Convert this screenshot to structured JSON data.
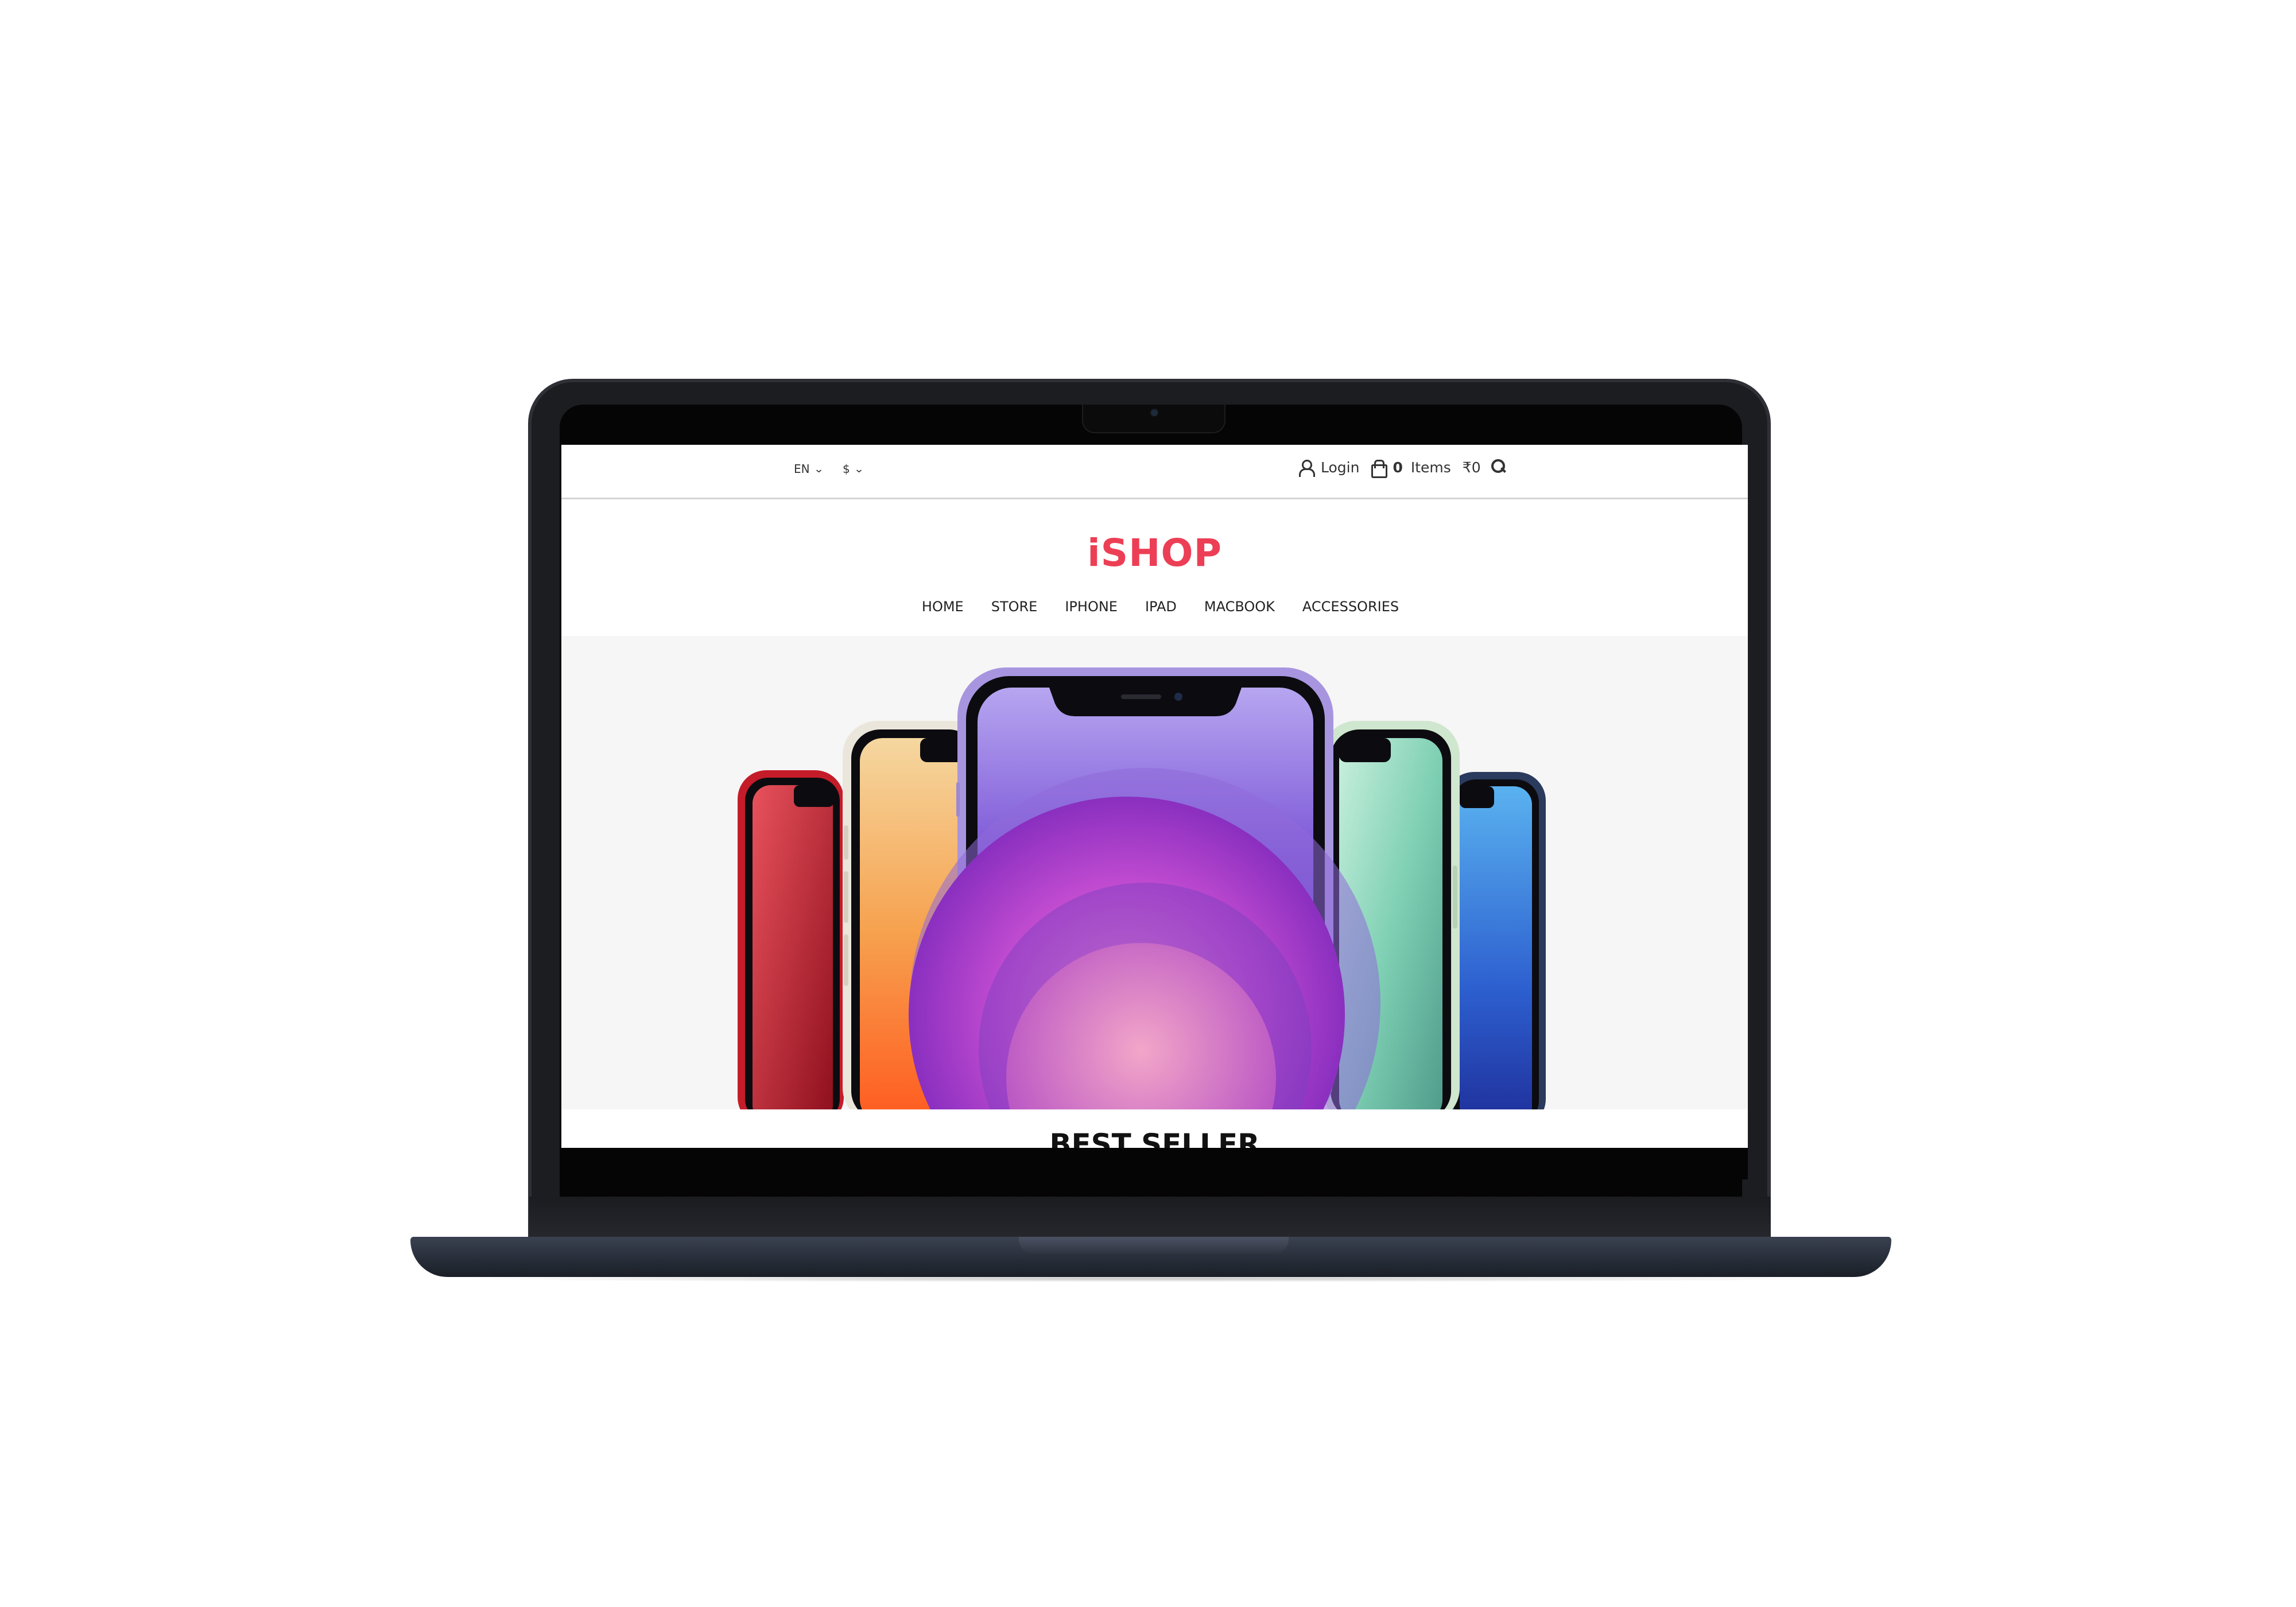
{
  "topbar": {
    "language": "EN",
    "currency": "$",
    "login_label": "Login",
    "cart_count": "0",
    "cart_label": "Items",
    "cart_total": "₹0"
  },
  "brand": {
    "logo_text": "iSHOP",
    "accent_color": "#ec3f55"
  },
  "nav": {
    "items": [
      "HOME",
      "STORE",
      "IPHONE",
      "IPAD",
      "MACBOOK",
      "ACCESSORIES"
    ]
  },
  "hero": {
    "phone_colors": [
      "red",
      "white",
      "purple",
      "green",
      "blue"
    ]
  },
  "sections": {
    "best_seller_title": "BEST SELLER"
  },
  "icons": [
    "chevron-down-icon",
    "user-icon",
    "bag-icon",
    "search-icon",
    "camera-icon"
  ]
}
